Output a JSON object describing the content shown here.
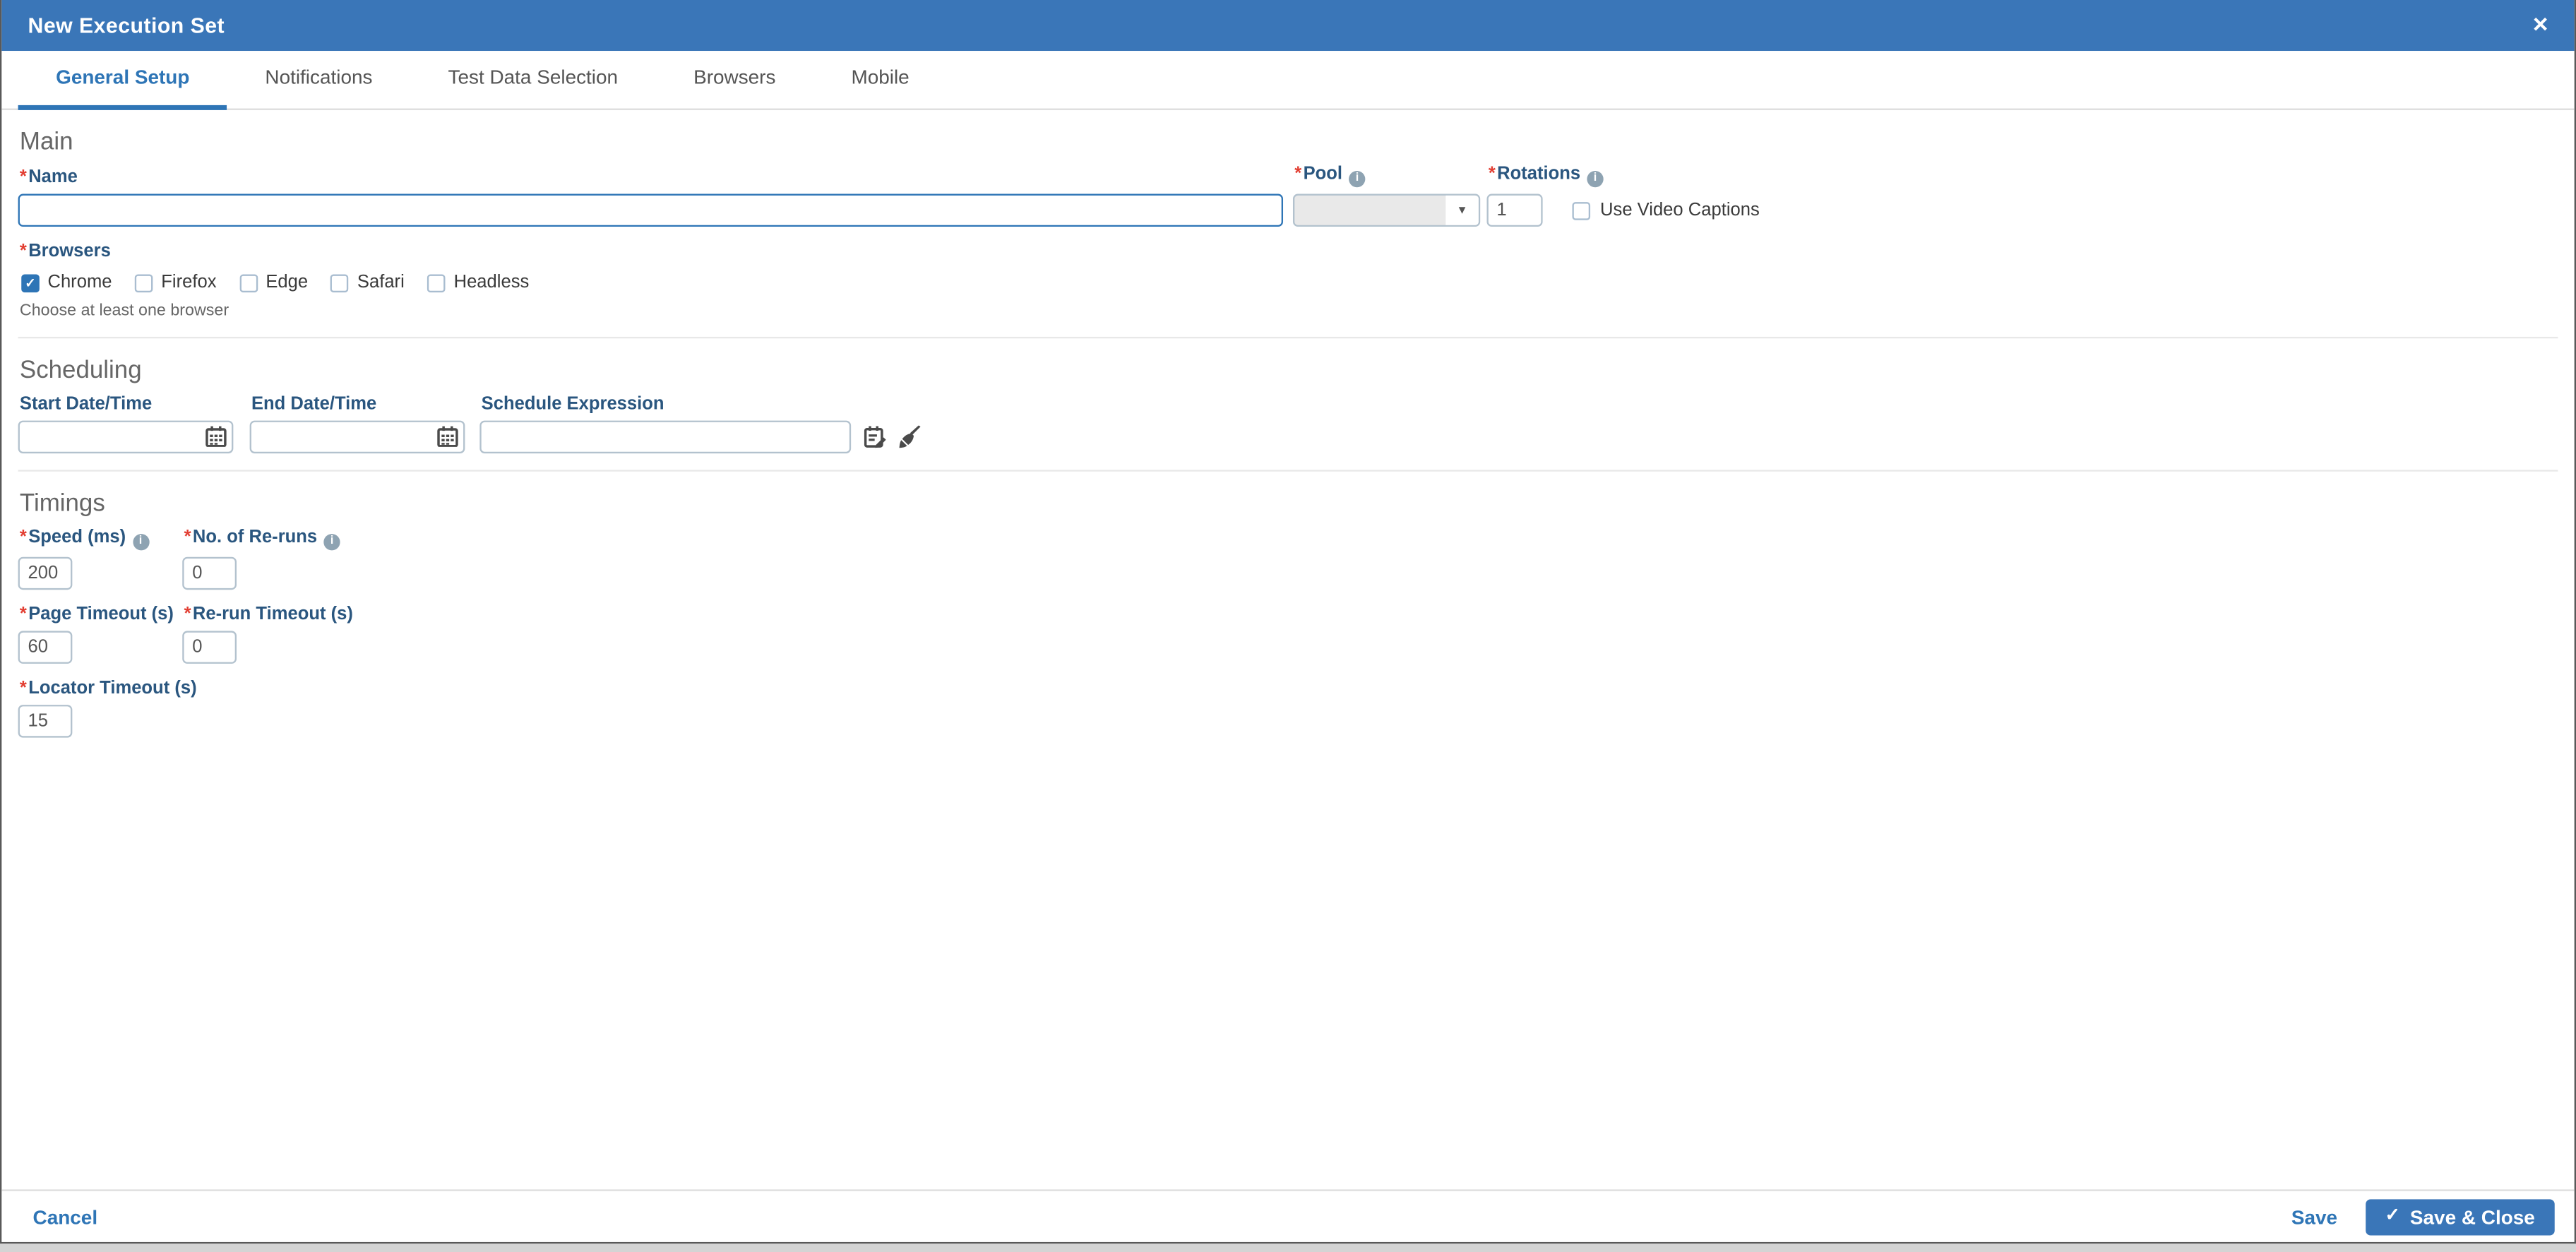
{
  "modal": {
    "title": "New Execution Set"
  },
  "icons": {
    "close_glyph": "×",
    "dropdown_glyph": "▼",
    "check_glyph": "✓",
    "info_glyph": "i"
  },
  "tabs": [
    {
      "label": "General Setup",
      "active": true
    },
    {
      "label": "Notifications",
      "active": false
    },
    {
      "label": "Test Data Selection",
      "active": false
    },
    {
      "label": "Browsers",
      "active": false
    },
    {
      "label": "Mobile",
      "active": false
    }
  ],
  "required_marker": "*",
  "main": {
    "heading": "Main",
    "name_label": "Name",
    "name_value": "",
    "pool_label": "Pool",
    "pool_value": "",
    "rotations_label": "Rotations",
    "rotations_value": "1",
    "video_captions_label": "Use Video Captions",
    "video_captions_checked": false,
    "browsers_label": "Browsers",
    "browsers": [
      {
        "label": "Chrome",
        "checked": true
      },
      {
        "label": "Firefox",
        "checked": false
      },
      {
        "label": "Edge",
        "checked": false
      },
      {
        "label": "Safari",
        "checked": false
      },
      {
        "label": "Headless",
        "checked": false
      }
    ],
    "browsers_helper": "Choose at least one browser"
  },
  "scheduling": {
    "heading": "Scheduling",
    "start_label": "Start Date/Time",
    "start_value": "",
    "end_label": "End Date/Time",
    "end_value": "",
    "expression_label": "Schedule Expression",
    "expression_value": ""
  },
  "timings": {
    "heading": "Timings",
    "fields": [
      {
        "label": "Speed (ms)",
        "value": "200"
      },
      {
        "label": "No. of Re-runs",
        "value": "0"
      },
      {
        "label": "Page Timeout (s)",
        "value": "60"
      },
      {
        "label": "Re-run Timeout (s)",
        "value": "0"
      },
      {
        "label": "Locator Timeout (s)",
        "value": "15"
      }
    ]
  },
  "footer": {
    "cancel": "Cancel",
    "save": "Save",
    "save_close": "Save & Close"
  },
  "colors": {
    "header_blue": "#3a76b8",
    "link_blue": "#2e75b6",
    "label_blue": "#2a567f",
    "required_red": "#e23e32",
    "input_border": "#b3c2ce"
  }
}
